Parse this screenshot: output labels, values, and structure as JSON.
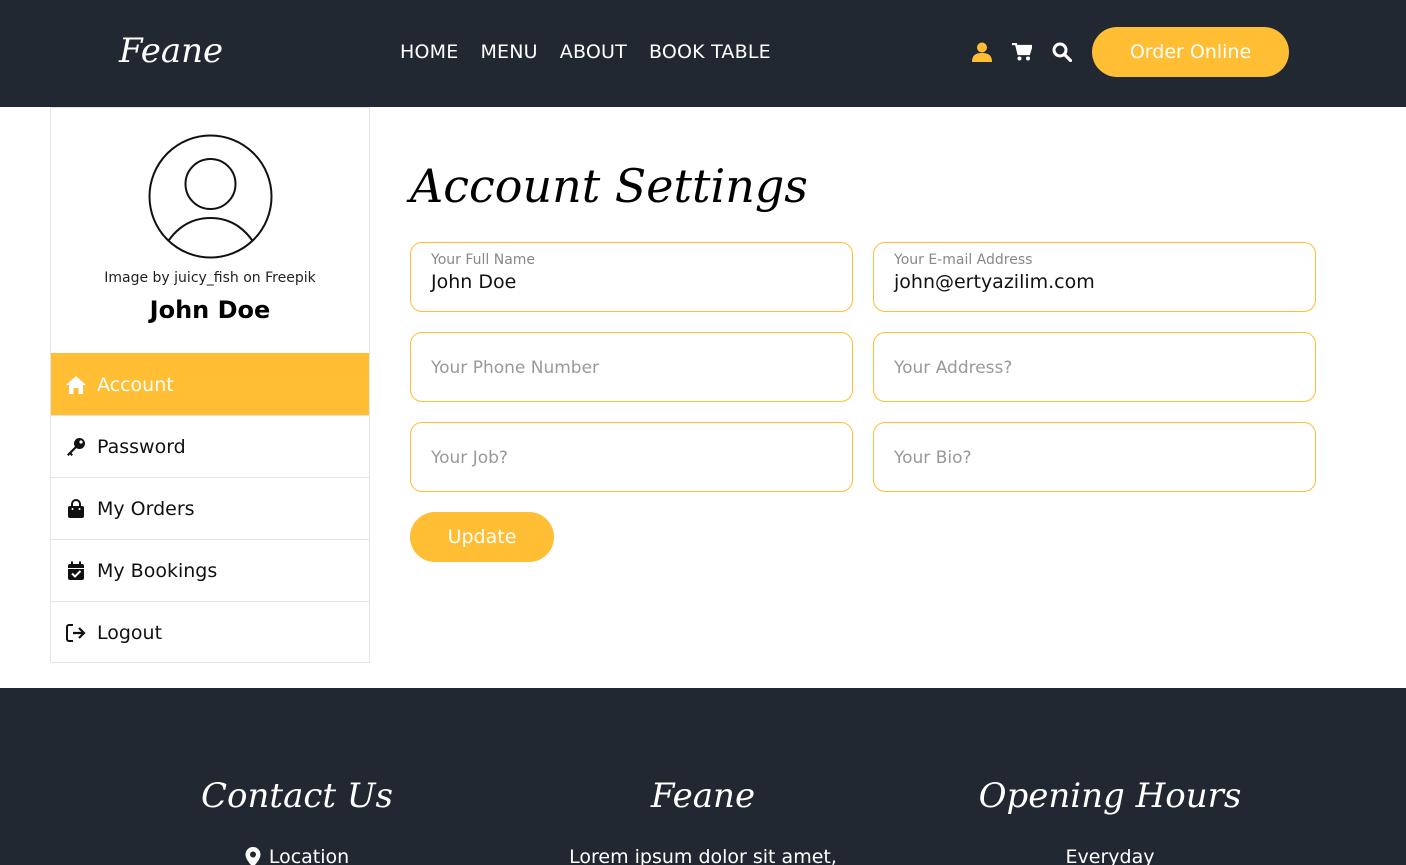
{
  "header": {
    "brand": "Feane",
    "nav": [
      "HOME",
      "MENU",
      "ABOUT",
      "BOOK TABLE"
    ],
    "order_button": "Order Online",
    "icons": [
      "user-icon",
      "cart-icon",
      "search-icon"
    ],
    "accent_color": "#ffbe33",
    "bg_color": "#222831"
  },
  "sidebar": {
    "image_credit": "Image by juicy_fish on Freepik",
    "user_name": "John Doe",
    "items": [
      {
        "label": "Account",
        "icon": "home-icon",
        "active": true
      },
      {
        "label": "Password",
        "icon": "key-icon",
        "active": false
      },
      {
        "label": "My Orders",
        "icon": "bag-icon",
        "active": false
      },
      {
        "label": "My Bookings",
        "icon": "calendar-check-icon",
        "active": false
      },
      {
        "label": "Logout",
        "icon": "logout-icon",
        "active": false
      }
    ]
  },
  "main": {
    "title": "Account Settings",
    "fields": {
      "full_name": {
        "label": "Your Full Name",
        "value": "John Doe"
      },
      "email": {
        "label": "Your E-mail Address",
        "value": "john@ertyazilim.com"
      },
      "phone": {
        "placeholder": "Your Phone Number"
      },
      "address": {
        "placeholder": "Your Address?"
      },
      "job": {
        "placeholder": "Your Job?"
      },
      "bio": {
        "placeholder": "Your Bio?"
      }
    },
    "update_button": "Update"
  },
  "footer": {
    "contact_title": "Contact Us",
    "contact_first": "Location",
    "brand_title": "Feane",
    "brand_text": "Lorem ipsum dolor sit amet,",
    "hours_title": "Opening Hours",
    "hours_text": "Everyday"
  }
}
